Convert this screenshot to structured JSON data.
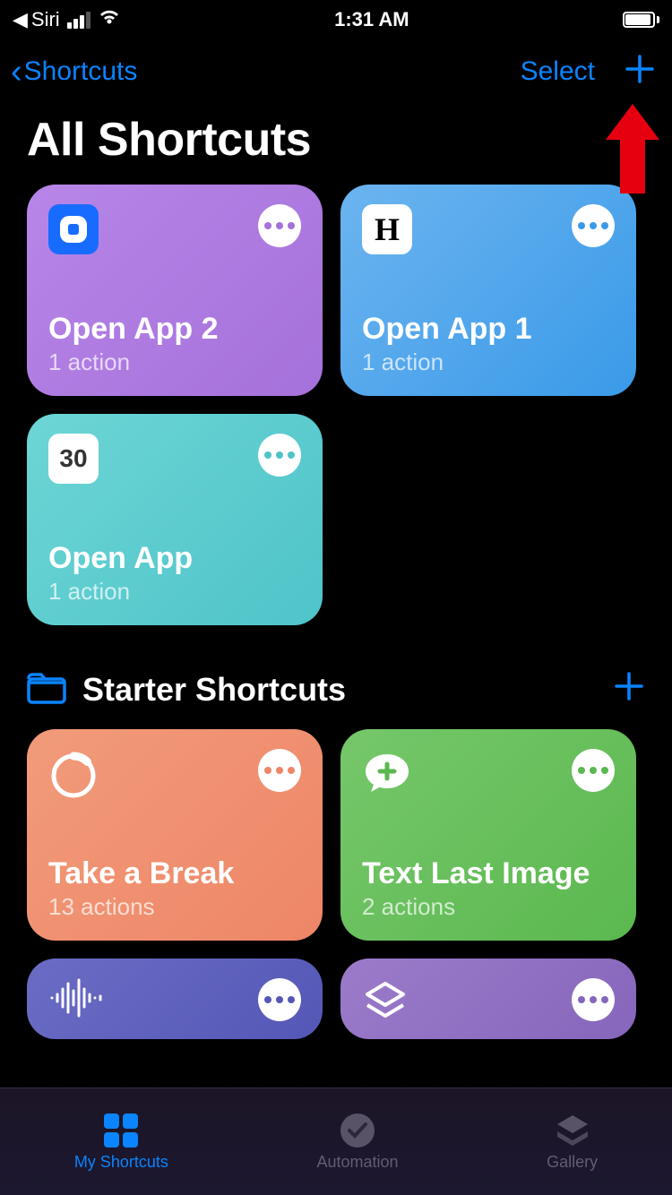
{
  "status": {
    "back_app": "Siri",
    "time": "1:31 AM"
  },
  "nav": {
    "back_label": "Shortcuts",
    "select_label": "Select"
  },
  "page": {
    "title": "All Shortcuts"
  },
  "shortcuts": [
    {
      "title": "Open App 2",
      "sub": "1 action"
    },
    {
      "title": "Open App 1",
      "sub": "1 action"
    },
    {
      "title": "Open App",
      "sub": "1 action"
    }
  ],
  "section": {
    "title": "Starter Shortcuts"
  },
  "starters": [
    {
      "title": "Take a Break",
      "sub": "13 actions"
    },
    {
      "title": "Text Last Image",
      "sub": "2 actions"
    }
  ],
  "calendar_day": "30",
  "tabs": {
    "my": "My Shortcuts",
    "auto": "Automation",
    "gallery": "Gallery"
  }
}
